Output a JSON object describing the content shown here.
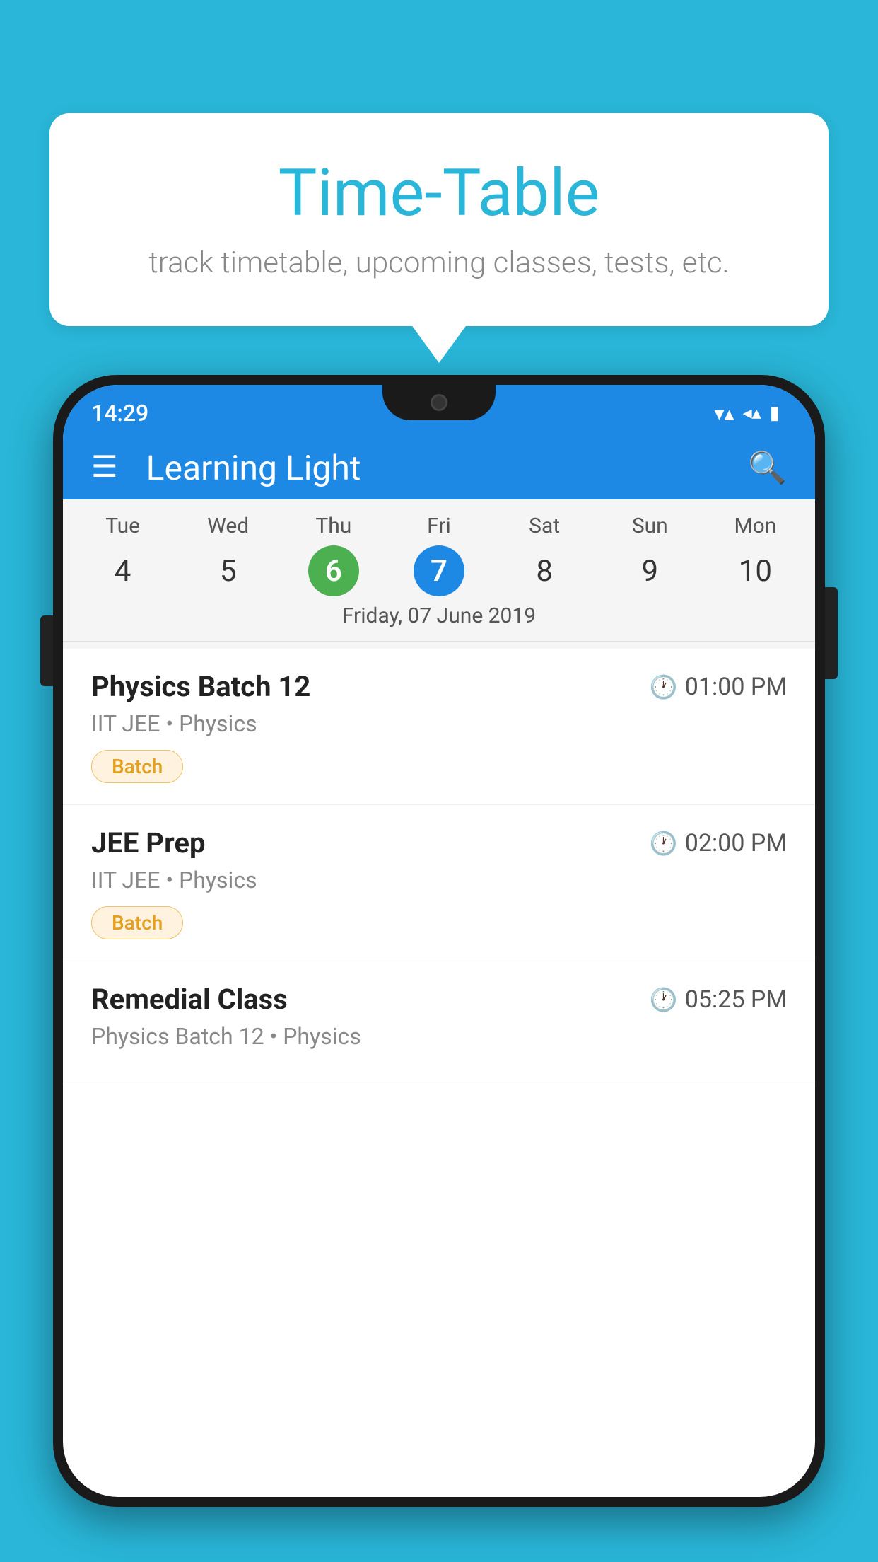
{
  "background_color": "#29b6d8",
  "bubble": {
    "title": "Time-Table",
    "subtitle": "track timetable, upcoming classes, tests, etc."
  },
  "phone": {
    "status_bar": {
      "time": "14:29"
    },
    "header": {
      "title": "Learning Light"
    },
    "calendar": {
      "days": [
        {
          "label": "Tue",
          "number": "4",
          "state": "normal"
        },
        {
          "label": "Wed",
          "number": "5",
          "state": "normal"
        },
        {
          "label": "Thu",
          "number": "6",
          "state": "today"
        },
        {
          "label": "Fri",
          "number": "7",
          "state": "selected"
        },
        {
          "label": "Sat",
          "number": "8",
          "state": "normal"
        },
        {
          "label": "Sun",
          "number": "9",
          "state": "normal"
        },
        {
          "label": "Mon",
          "number": "10",
          "state": "normal"
        }
      ],
      "selected_date_label": "Friday, 07 June 2019"
    },
    "schedule": [
      {
        "name": "Physics Batch 12",
        "time": "01:00 PM",
        "sub": "IIT JEE • Physics",
        "tag": "Batch"
      },
      {
        "name": "JEE Prep",
        "time": "02:00 PM",
        "sub": "IIT JEE • Physics",
        "tag": "Batch"
      },
      {
        "name": "Remedial Class",
        "time": "05:25 PM",
        "sub": "Physics Batch 12 • Physics",
        "tag": null
      }
    ]
  }
}
